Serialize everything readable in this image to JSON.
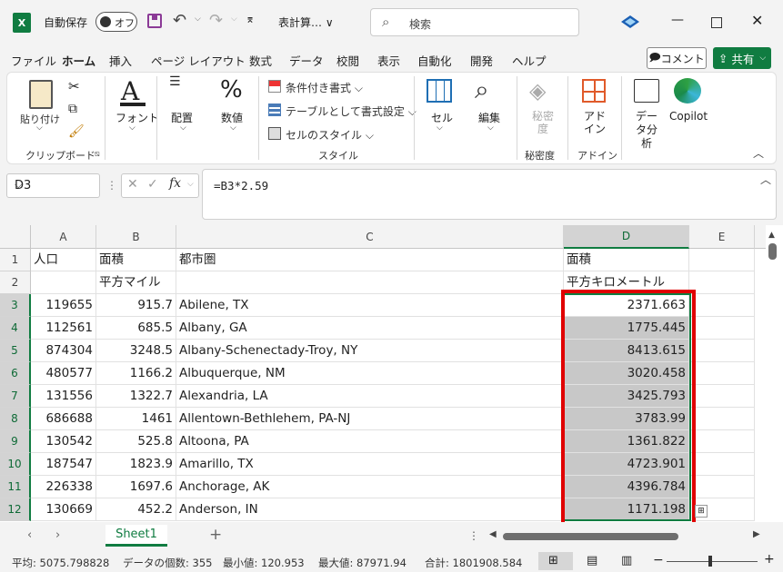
{
  "titlebar": {
    "app_icon": "X",
    "autosave_label": "自動保存",
    "autosave_state": "オフ",
    "doc_title": "表計算… ∨",
    "search_placeholder": "検索"
  },
  "menu_tabs": [
    "ファイル",
    "ホーム",
    "挿入",
    "ページ レイアウト",
    "数式",
    "データ",
    "校閲",
    "表示",
    "自動化",
    "開発",
    "ヘルプ"
  ],
  "comment_label": "コメント",
  "share_label": "共有",
  "ribbon": {
    "paste": "貼り付け",
    "clipboard": "クリップボード",
    "font": "フォント",
    "align": "配置",
    "number": "数値",
    "cond_format": "条件付き書式",
    "table_format": "テーブルとして書式設定",
    "cell_style": "セルのスタイル",
    "styles": "スタイル",
    "cells": "セル",
    "editing": "編集",
    "sensitivity": "秘密度",
    "sensitivity_label": "秘密度",
    "addin": "アドイン",
    "addin_group": "アドイン",
    "data_analysis": "データ分析",
    "copilot": "Copilot"
  },
  "namebox": "D3",
  "formula": "=B3*2.59",
  "columns": [
    "A",
    "B",
    "C",
    "D",
    "E"
  ],
  "rows": [
    {
      "n": "1",
      "a": "人口",
      "b": "面積",
      "c": "都市圏",
      "d": "面積"
    },
    {
      "n": "2",
      "a": "",
      "b": "平方マイル",
      "c": "",
      "d": "平方キロメートル"
    },
    {
      "n": "3",
      "a": "119655",
      "b": "915.7",
      "c": "Abilene, TX",
      "d": "2371.663"
    },
    {
      "n": "4",
      "a": "112561",
      "b": "685.5",
      "c": "Albany, GA",
      "d": "1775.445"
    },
    {
      "n": "5",
      "a": "874304",
      "b": "3248.5",
      "c": "Albany-Schenectady-Troy, NY",
      "d": "8413.615"
    },
    {
      "n": "6",
      "a": "480577",
      "b": "1166.2",
      "c": "Albuquerque, NM",
      "d": "3020.458"
    },
    {
      "n": "7",
      "a": "131556",
      "b": "1322.7",
      "c": "Alexandria, LA",
      "d": "3425.793"
    },
    {
      "n": "8",
      "a": "686688",
      "b": "1461",
      "c": "Allentown-Bethlehem, PA-NJ",
      "d": "3783.99"
    },
    {
      "n": "9",
      "a": "130542",
      "b": "525.8",
      "c": "Altoona, PA",
      "d": "1361.822"
    },
    {
      "n": "10",
      "a": "187547",
      "b": "1823.9",
      "c": "Amarillo, TX",
      "d": "4723.901"
    },
    {
      "n": "11",
      "a": "226338",
      "b": "1697.6",
      "c": "Anchorage, AK",
      "d": "4396.784"
    },
    {
      "n": "12",
      "a": "130669",
      "b": "452.2",
      "c": "Anderson, IN",
      "d": "1171.198"
    }
  ],
  "sheet_tab": "Sheet1",
  "status": {
    "avg": "平均: 5075.798828",
    "count": "データの個数: 355",
    "min": "最小値: 120.953",
    "max": "最大値: 87971.94",
    "sum": "合計: 1801908.584"
  }
}
